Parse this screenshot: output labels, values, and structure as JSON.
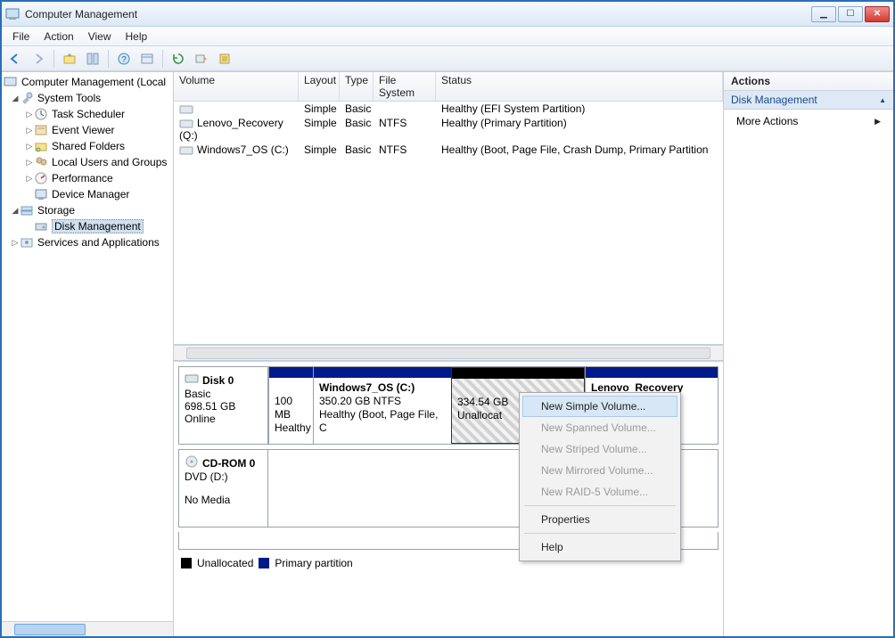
{
  "window": {
    "title": "Computer Management"
  },
  "menu": {
    "file": "File",
    "action": "Action",
    "view": "View",
    "help": "Help"
  },
  "tree": {
    "root": "Computer Management (Local",
    "system_tools": "System Tools",
    "task_scheduler": "Task Scheduler",
    "event_viewer": "Event Viewer",
    "shared_folders": "Shared Folders",
    "local_users": "Local Users and Groups",
    "performance": "Performance",
    "device_manager": "Device Manager",
    "storage": "Storage",
    "disk_management": "Disk Management",
    "services": "Services and Applications"
  },
  "columns": {
    "volume": "Volume",
    "layout": "Layout",
    "type": "Type",
    "fs": "File System",
    "status": "Status"
  },
  "volumes": [
    {
      "name": "",
      "layout": "Simple",
      "type": "Basic",
      "fs": "",
      "status": "Healthy (EFI System Partition)"
    },
    {
      "name": "Lenovo_Recovery (Q:)",
      "layout": "Simple",
      "type": "Basic",
      "fs": "NTFS",
      "status": "Healthy (Primary Partition)"
    },
    {
      "name": "Windows7_OS (C:)",
      "layout": "Simple",
      "type": "Basic",
      "fs": "NTFS",
      "status": "Healthy (Boot, Page File, Crash Dump, Primary Partition"
    }
  ],
  "disk0": {
    "title": "Disk 0",
    "kind": "Basic",
    "size": "698.51 GB",
    "state": "Online",
    "p1_size": "100 MB",
    "p1_status": "Healthy",
    "p2_name": "Windows7_OS  (C:)",
    "p2_fs": "350.20 GB NTFS",
    "p2_status": "Healthy (Boot, Page File, C",
    "p3_size": "334.54 GB",
    "p3_status": "Unallocat",
    "p4_name": "Lenovo_Recovery"
  },
  "cdrom": {
    "title": "CD-ROM 0",
    "drive": "DVD (D:)",
    "state": "No Media"
  },
  "legend": {
    "unallocated": "Unallocated",
    "primary": "Primary partition"
  },
  "ctx": {
    "new_simple": "New Simple Volume...",
    "new_spanned": "New Spanned Volume...",
    "new_striped": "New Striped Volume...",
    "new_mirrored": "New Mirrored Volume...",
    "new_raid5": "New RAID-5 Volume...",
    "properties": "Properties",
    "help": "Help"
  },
  "actions": {
    "header": "Actions",
    "section": "Disk Management",
    "more": "More Actions"
  }
}
